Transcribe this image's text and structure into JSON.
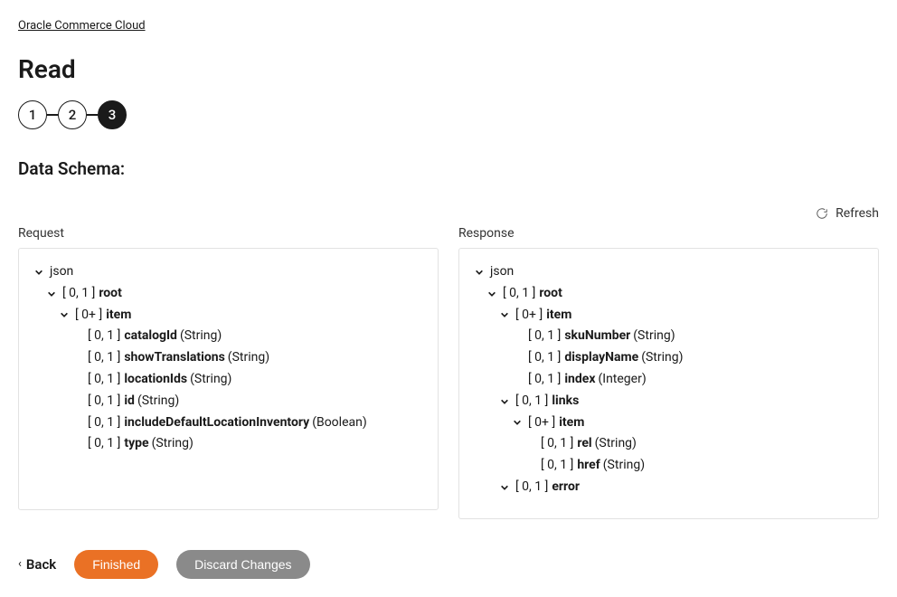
{
  "breadcrumb": "Oracle Commerce Cloud",
  "page_title": "Read",
  "stepper": {
    "s1": "1",
    "s2": "2",
    "s3": "3"
  },
  "section_title": "Data Schema:",
  "refresh_label": "Refresh",
  "request_label": "Request",
  "response_label": "Response",
  "common": {
    "json": "json",
    "r01": "[ 0, 1 ]",
    "r0p": "[ 0+ ]",
    "tString": "(String)",
    "tBoolean": "(Boolean)",
    "tInteger": "(Integer)"
  },
  "request": {
    "root": "root",
    "item": "item",
    "catalogId": "catalogId",
    "showTranslations": "showTranslations",
    "locationIds": "locationIds",
    "id": "id",
    "includeDefaultLocationInventory": "includeDefaultLocationInventory",
    "type": "type"
  },
  "response": {
    "root": "root",
    "item": "item",
    "skuNumber": "skuNumber",
    "displayName": "displayName",
    "index": "index",
    "links": "links",
    "linksItem": "item",
    "rel": "rel",
    "href": "href",
    "error": "error"
  },
  "footer": {
    "back": "Back",
    "finished": "Finished",
    "discard": "Discard Changes"
  }
}
